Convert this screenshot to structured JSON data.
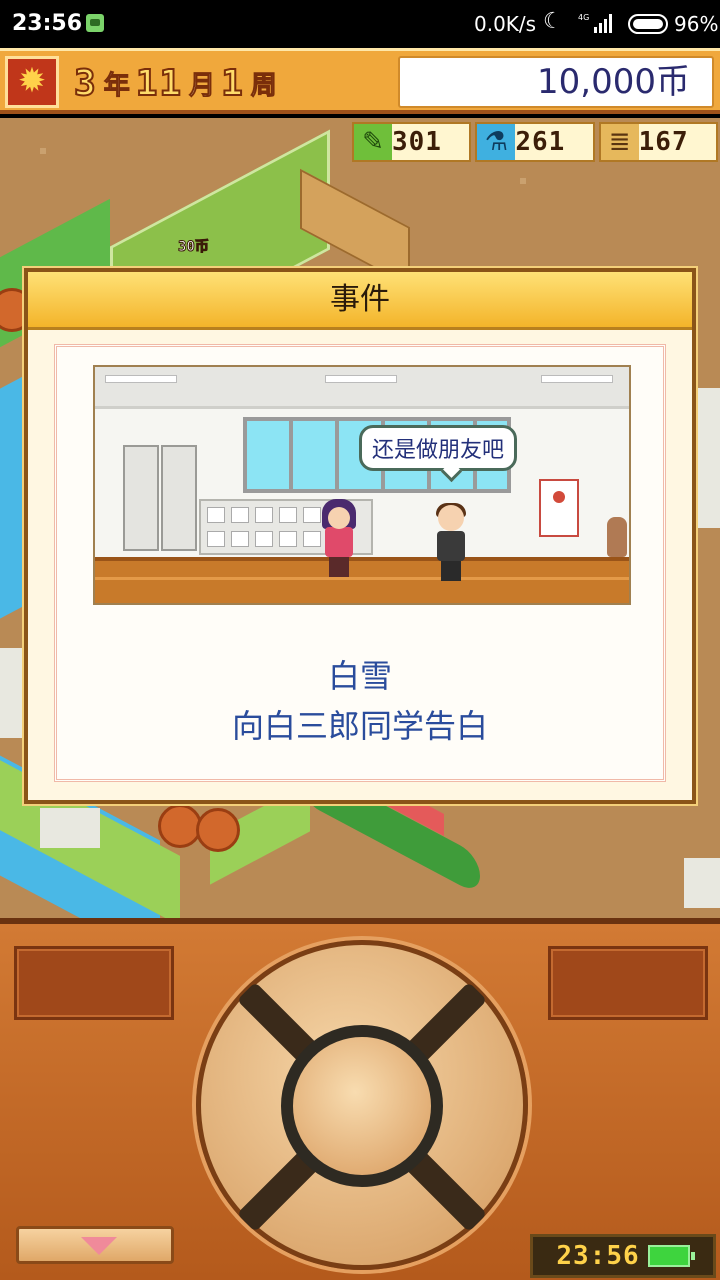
{
  "status_bar": {
    "time": "23:56",
    "speed": "0.0K/s",
    "network": "4G",
    "battery_percent": "96%",
    "battery_level": 0.96
  },
  "game_header": {
    "year": "3",
    "year_unit": "年",
    "month": "11",
    "month_unit": "月",
    "week": "1",
    "week_unit": "周",
    "season_icon": "maple-leaf-icon",
    "money": "10,000币"
  },
  "resources": [
    {
      "icon": "pencil-icon",
      "value": "301"
    },
    {
      "icon": "flask-icon",
      "value": "261"
    },
    {
      "icon": "book-stack-icon",
      "value": "167"
    }
  ],
  "map": {
    "price_tag": "30币"
  },
  "event_dialog": {
    "title": "事件",
    "speech_bubble": "还是做朋友吧",
    "student_name": "白雪",
    "description": "向白三郎同学告白"
  },
  "controller": {
    "clock": "23:56",
    "battery_icon": "battery-icon"
  },
  "colors": {
    "header_orange": "#f0a83c",
    "dialog_text_blue": "#2a4c9c",
    "money_text": "#2a2a6e"
  }
}
